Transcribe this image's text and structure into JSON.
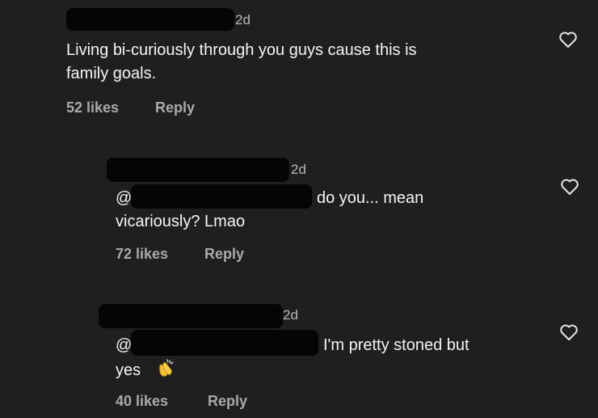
{
  "comments": [
    {
      "time": "2d",
      "line1": "Living bi-curiously through you guys cause this is",
      "line2": "family goals.",
      "likes": "52 likes",
      "reply": "Reply"
    },
    {
      "time": "2d",
      "mention": "@",
      "line1_tail": "do you... mean",
      "line2": "vicariously? Lmao",
      "likes": "72 likes",
      "reply": "Reply"
    },
    {
      "time": "2d",
      "mention": "@",
      "line1_tail": "I'm pretty stoned but",
      "line2": "yes",
      "likes": "40 likes",
      "reply": "Reply"
    }
  ],
  "icons": {
    "like": "heart-outline-icon",
    "reaction": "clapping-hands-emoji"
  }
}
